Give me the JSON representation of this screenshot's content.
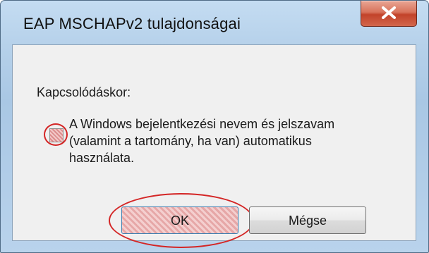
{
  "window": {
    "title": "EAP MSCHAPv2 tulajdonságai"
  },
  "dialog": {
    "label": "Kapcsolódáskor:",
    "checkbox": {
      "checked": false,
      "lines": [
        "A Windows bejelentkezési nevem és jelszavam",
        "(valamint a tartomány, ha van) automatikus",
        "használata."
      ]
    },
    "buttons": {
      "ok": "OK",
      "cancel": "Mégse"
    }
  },
  "icons": {
    "close": "close-icon"
  },
  "colors": {
    "highlight_ring": "#d42626",
    "close_button": "#c2432a"
  }
}
